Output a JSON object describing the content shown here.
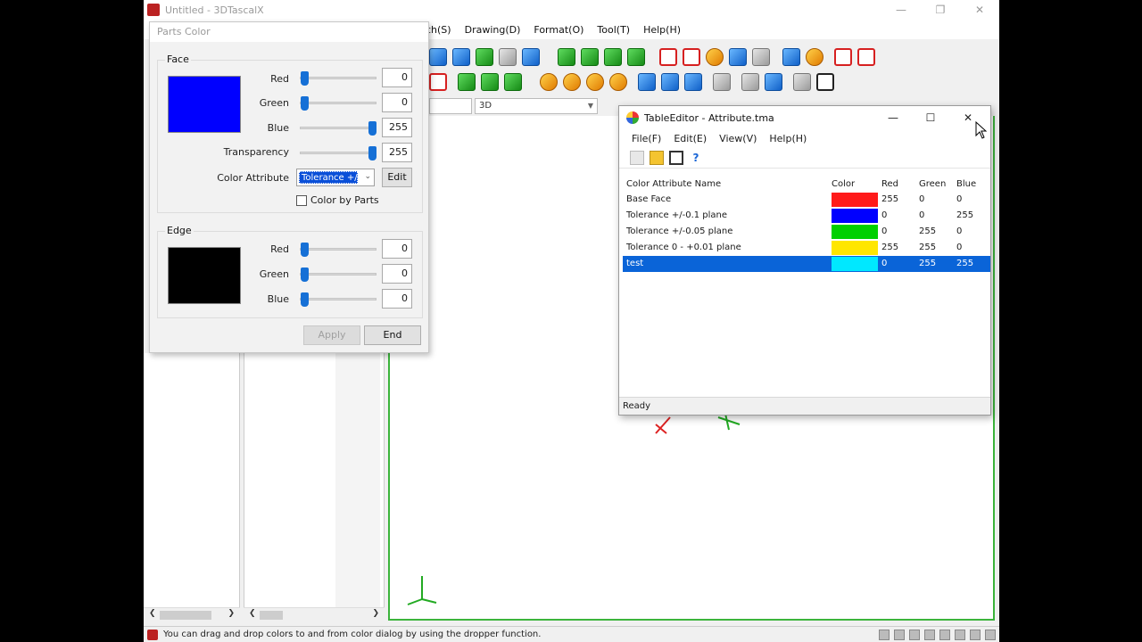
{
  "main_window": {
    "title": "Untitled - 3DTascalX",
    "menu": [
      "ch(S)",
      "Drawing(D)",
      "Format(O)",
      "Tool(T)",
      "Help(H)"
    ],
    "view_combo": "3D",
    "status_text": "You can drag and drop colors to and from color dialog by using the dropper function."
  },
  "parts_color": {
    "title": "Parts Color",
    "face": {
      "label": "Face",
      "swatch_color": "#0000ff",
      "red_label": "Red",
      "red": "0",
      "green_label": "Green",
      "green": "0",
      "blue_label": "Blue",
      "blue": "255",
      "transparency_label": "Transparency",
      "transparency": "255",
      "color_attribute_label": "Color Attribute",
      "color_attribute_value": "Tolerance +/",
      "edit_label": "Edit",
      "color_by_parts_label": "Color by Parts"
    },
    "edge": {
      "label": "Edge",
      "swatch_color": "#000000",
      "red_label": "Red",
      "red": "0",
      "green_label": "Green",
      "green": "0",
      "blue_label": "Blue",
      "blue": "0"
    },
    "apply_label": "Apply",
    "end_label": "End"
  },
  "table_editor": {
    "title": "TableEditor - Attribute.tma",
    "menu": [
      "File(F)",
      "Edit(E)",
      "View(V)",
      "Help(H)"
    ],
    "columns": [
      "Color Attribute Name",
      "Color",
      "Red",
      "Green",
      "Blue"
    ],
    "rows": [
      {
        "name": "Base Face",
        "color": "#ff1a1a",
        "red": "255",
        "green": "0",
        "blue": "0"
      },
      {
        "name": "Tolerance +/-0.1 plane",
        "color": "#0000ff",
        "red": "0",
        "green": "0",
        "blue": "255"
      },
      {
        "name": "Tolerance +/-0.05 plane",
        "color": "#00d000",
        "red": "0",
        "green": "255",
        "blue": "0"
      },
      {
        "name": "Tolerance 0 - +0.01 plane",
        "color": "#ffe600",
        "red": "255",
        "green": "255",
        "blue": "0"
      },
      {
        "name": "test",
        "color": "#00e8ff",
        "red": "0",
        "green": "255",
        "blue": "255"
      }
    ],
    "status": "Ready"
  }
}
